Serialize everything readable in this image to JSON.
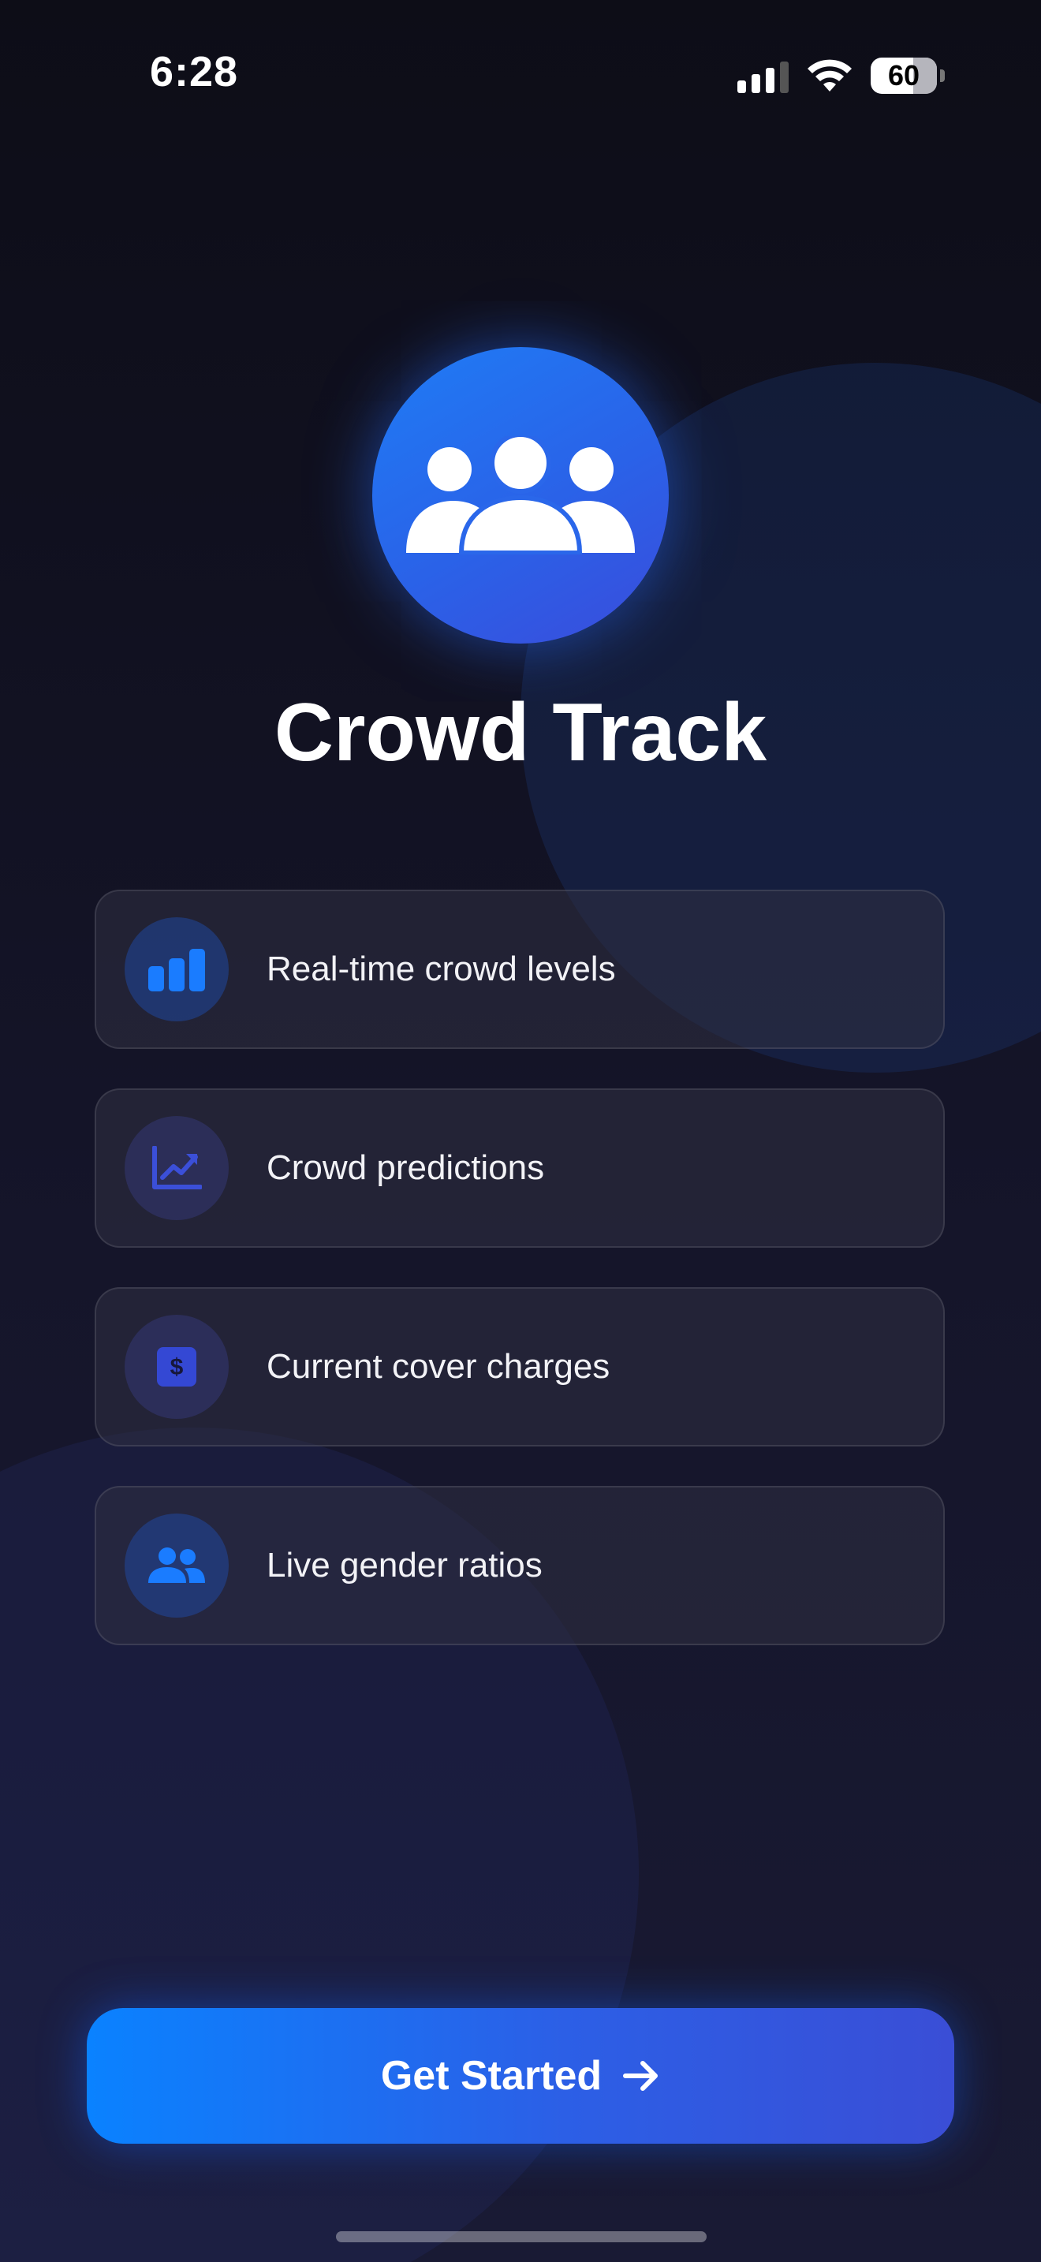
{
  "status_bar": {
    "time": "6:28",
    "battery": "60"
  },
  "app": {
    "title": "Crowd Track"
  },
  "features": [
    {
      "label": "Real-time crowd levels",
      "icon": "bar-chart-icon"
    },
    {
      "label": "Crowd predictions",
      "icon": "trend-chart-icon"
    },
    {
      "label": "Current cover charges",
      "icon": "dollar-icon"
    },
    {
      "label": "Live gender ratios",
      "icon": "people-icon"
    }
  ],
  "cta": {
    "label": "Get Started"
  },
  "colors": {
    "accent": "#1f7cf5",
    "background": "#12121c",
    "card": "#26263a"
  }
}
